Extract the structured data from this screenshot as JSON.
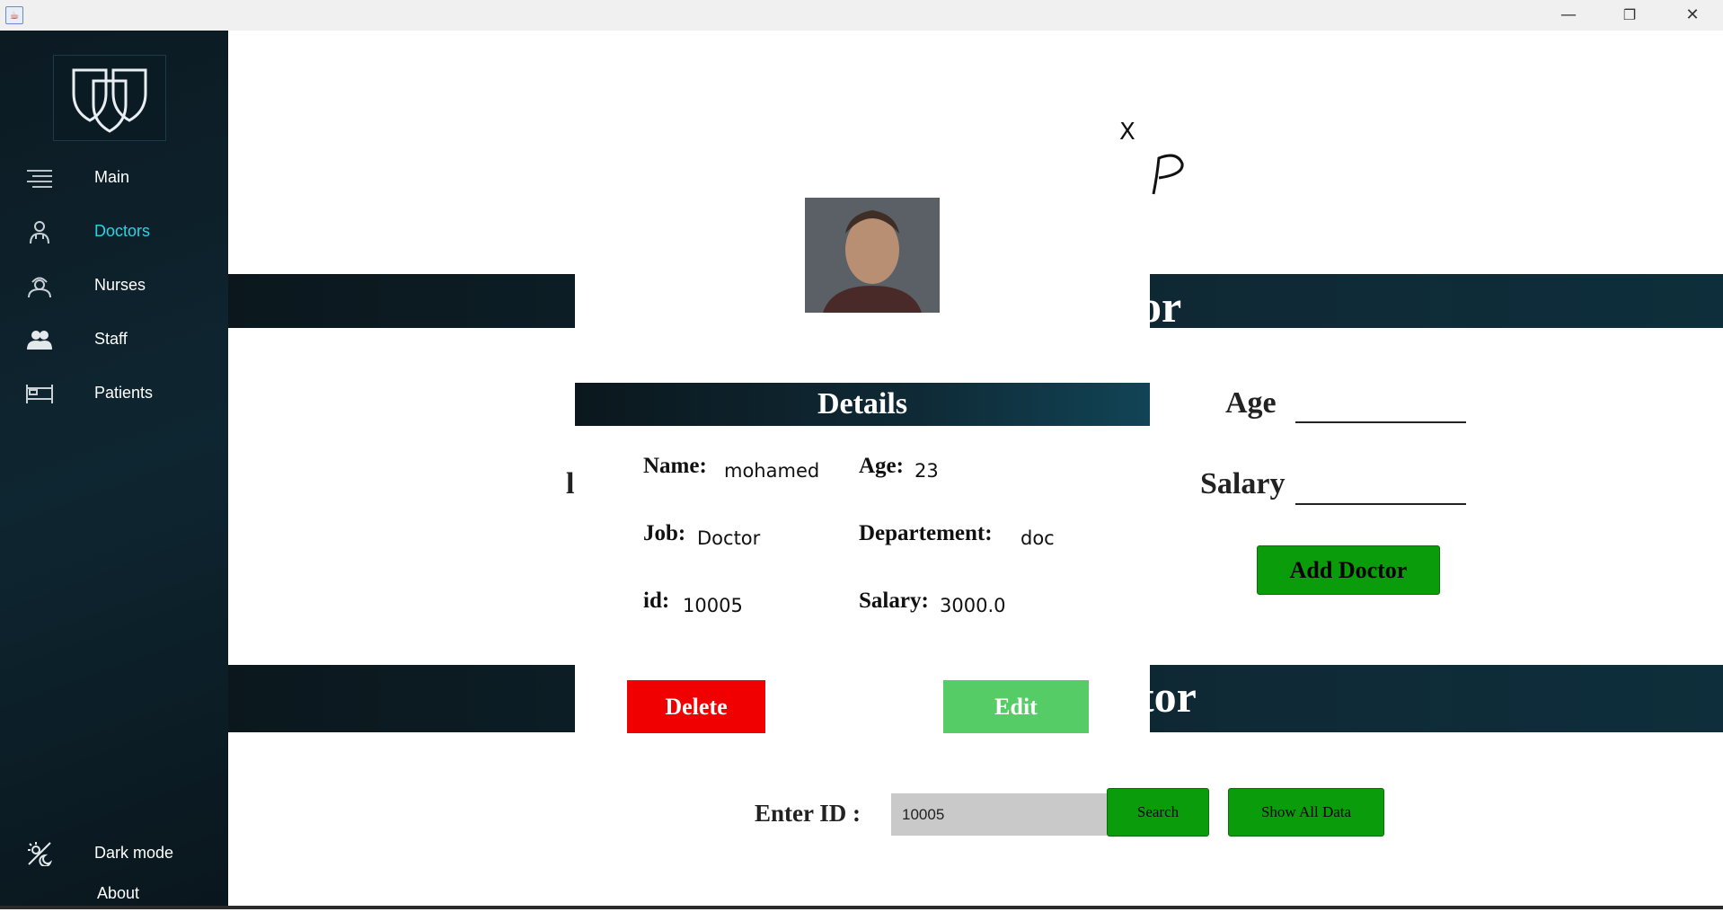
{
  "window": {
    "app_icon": "java-icon",
    "minimize": "—",
    "restore": "❐",
    "close": "✕"
  },
  "sidebar": {
    "logo": "hospital-shields-logo",
    "items": [
      {
        "label": "Main",
        "icon": "menu-lines-icon"
      },
      {
        "label": "Doctors",
        "icon": "doctor-icon",
        "active": true
      },
      {
        "label": "Nurses",
        "icon": "nurse-icon"
      },
      {
        "label": "Staff",
        "icon": "staff-icon"
      },
      {
        "label": "Patients",
        "icon": "bed-icon"
      }
    ],
    "dark_mode": {
      "label": "Dark mode",
      "icon": "dark-mode-icon"
    },
    "about": {
      "label": "About"
    }
  },
  "main": {
    "bar1_text_fragment": "or",
    "bar2_text_fragment": "tor",
    "left_fragment": "l",
    "age_label": "Age",
    "salary_label": "Salary",
    "add_button": "Add Doctor",
    "enter_id_label": "Enter ID :",
    "search_value": "10005",
    "search_button": "Search",
    "show_all_button": "Show All Data"
  },
  "dialog": {
    "close": "X",
    "header": "Details",
    "name_label": "Name:",
    "name_value": "mohamed",
    "age_label": "Age:",
    "age_value": "23",
    "job_label": "Job:",
    "job_value": "Doctor",
    "dept_label": "Departement:",
    "dept_value": "doc",
    "id_label": "id:",
    "id_value": "10005",
    "salary_label": "Salary:",
    "salary_value": "3000.0",
    "delete_button": "Delete",
    "edit_button": "Edit"
  },
  "colors": {
    "sidebar_bg": "#0e2631",
    "active_nav": "#2ad3e3",
    "green_button": "#0a9c0a",
    "delete_red": "#f10000",
    "edit_green": "#55cc66"
  }
}
